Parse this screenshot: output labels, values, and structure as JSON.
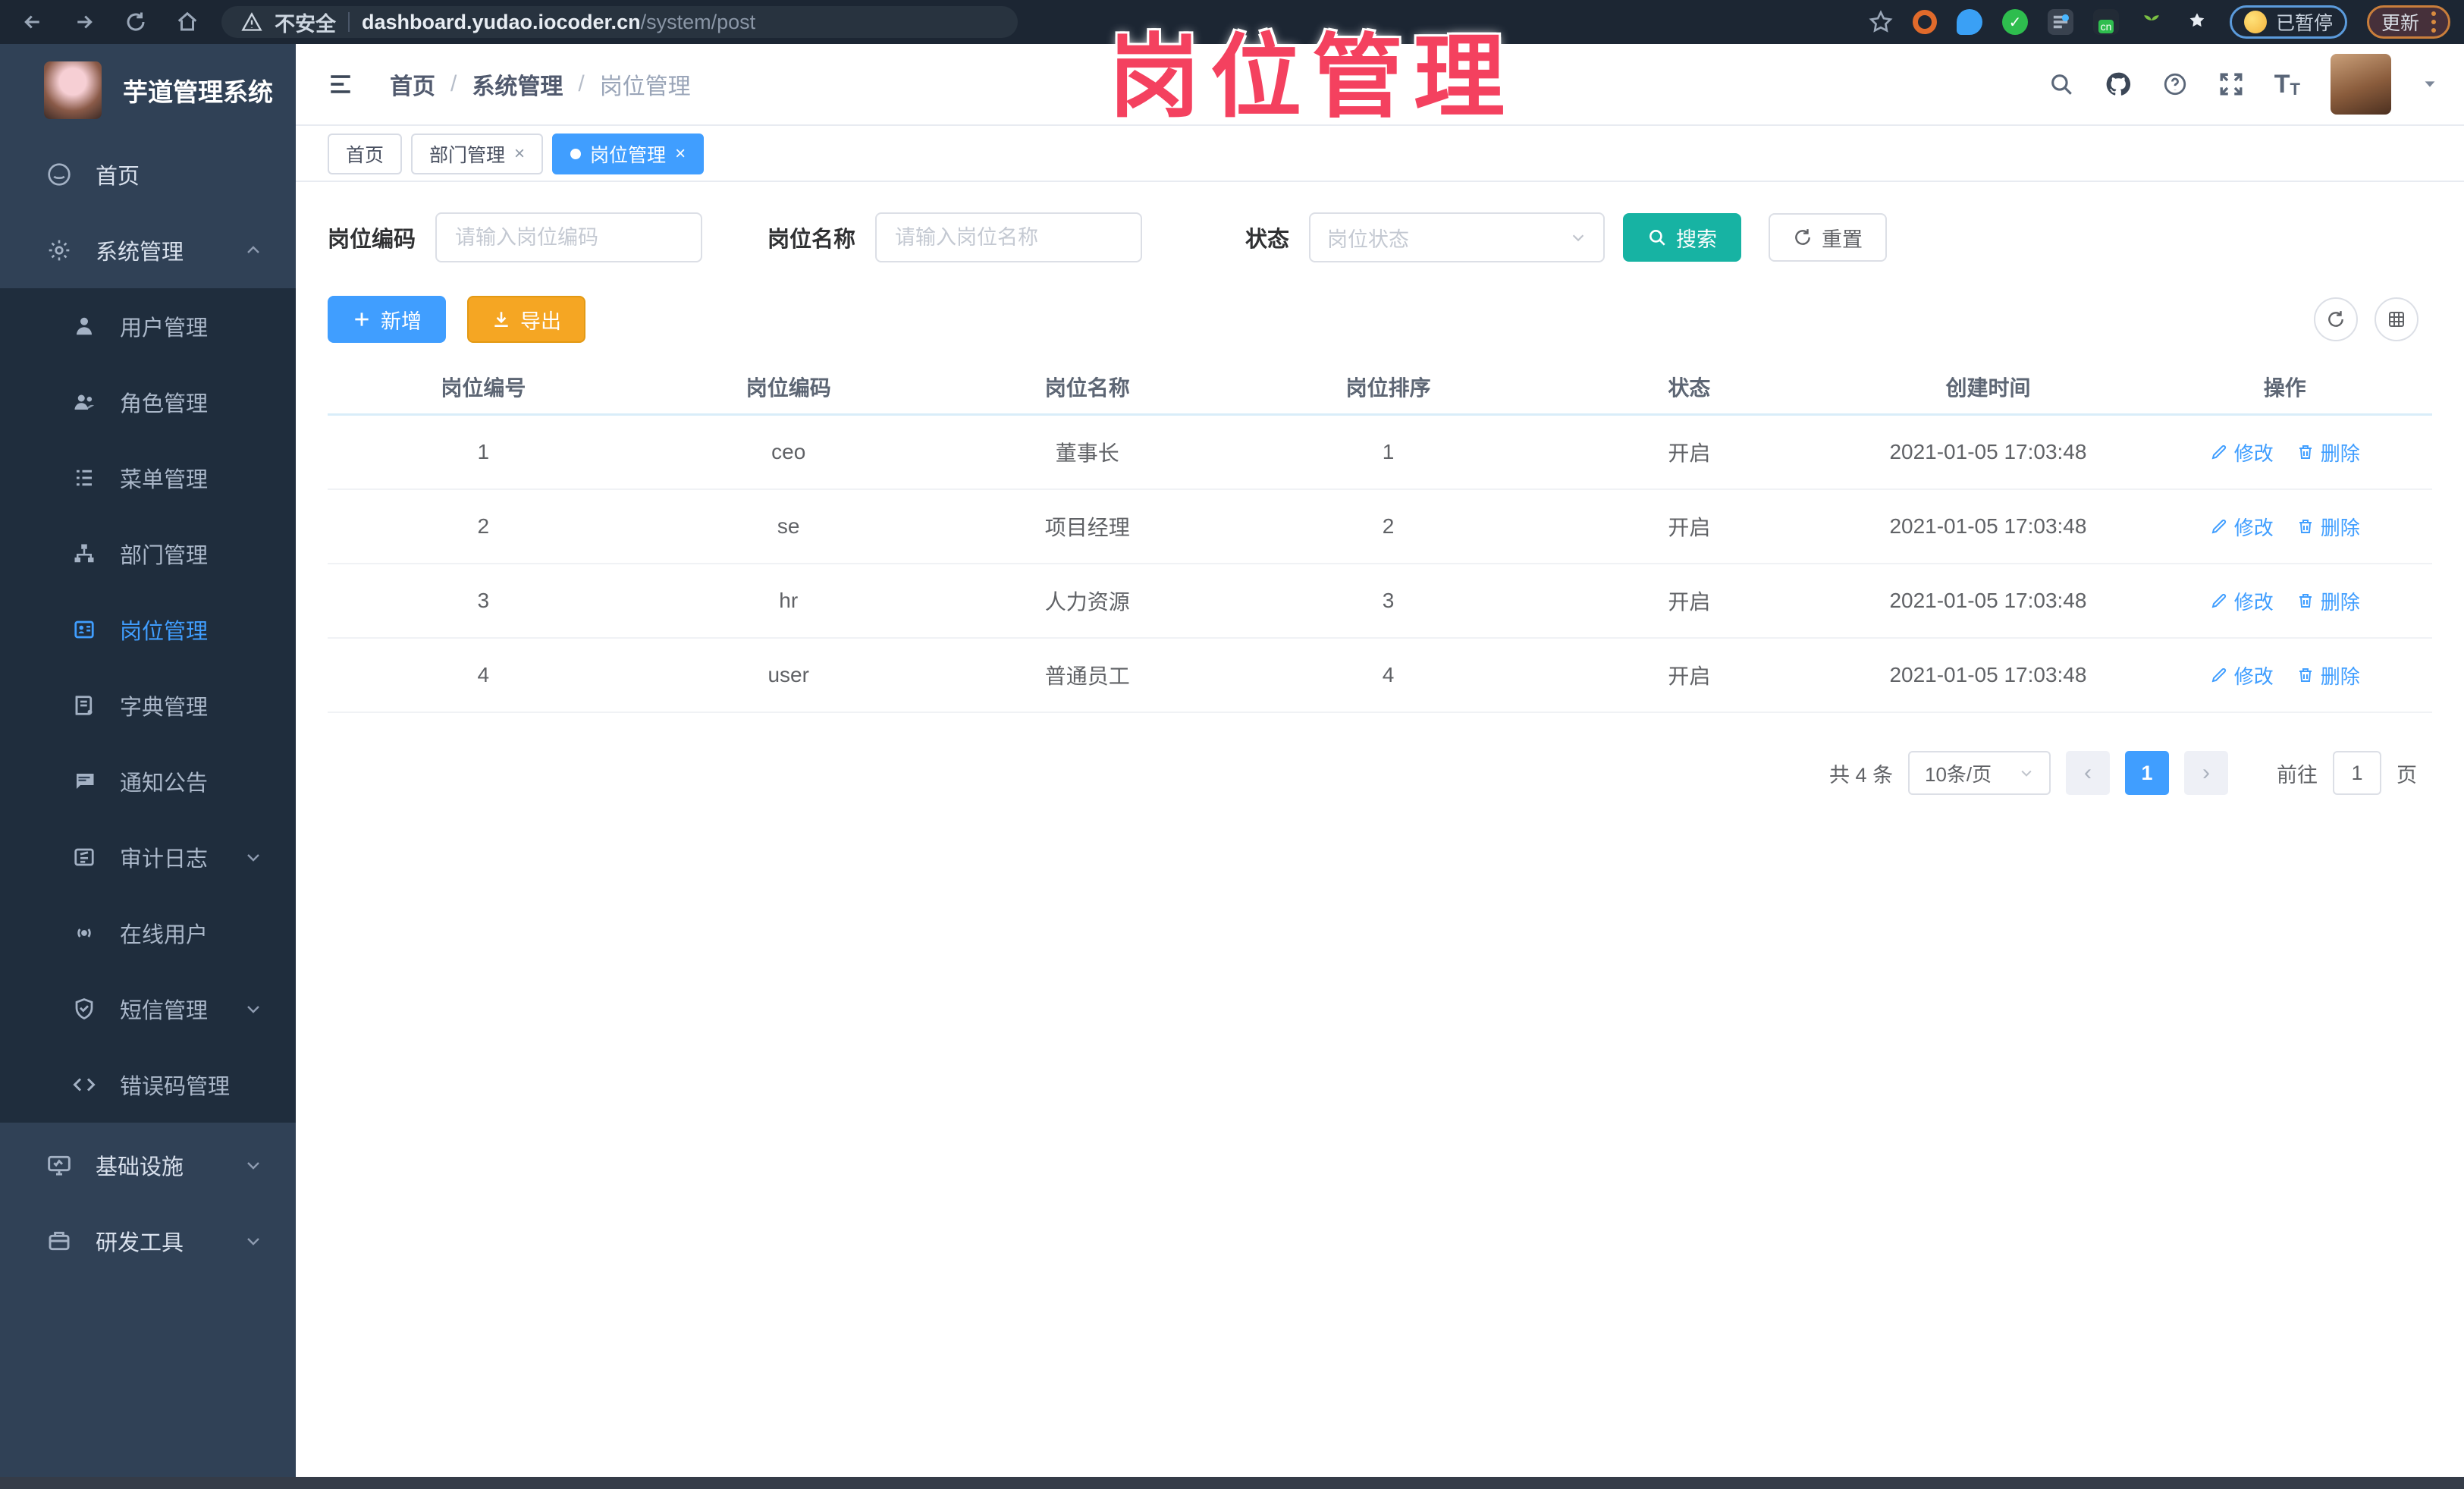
{
  "browser": {
    "security_label": "不安全",
    "url_host": "dashboard.yudao.iocoder.cn",
    "url_path": "/system/post",
    "paused_badge": "已暂停",
    "update_label": "更新"
  },
  "annotation": {
    "text": "岗位管理",
    "color": "#f4415f"
  },
  "sidebar": {
    "title": "芋道管理系统",
    "home_label": "首页",
    "system_label": "系统管理",
    "submenu": [
      {
        "label": "用户管理",
        "icon": "user-icon"
      },
      {
        "label": "角色管理",
        "icon": "roles-icon"
      },
      {
        "label": "菜单管理",
        "icon": "menu-list-icon"
      },
      {
        "label": "部门管理",
        "icon": "org-tree-icon"
      },
      {
        "label": "岗位管理",
        "icon": "post-badge-icon",
        "active": true
      },
      {
        "label": "字典管理",
        "icon": "dictionary-icon"
      },
      {
        "label": "通知公告",
        "icon": "notice-icon"
      },
      {
        "label": "审计日志",
        "icon": "audit-log-icon",
        "expandable": true
      },
      {
        "label": "在线用户",
        "icon": "online-users-icon"
      },
      {
        "label": "短信管理",
        "icon": "sms-icon",
        "expandable": true
      },
      {
        "label": "错误码管理",
        "icon": "error-code-icon"
      }
    ],
    "groups": [
      {
        "label": "基础设施",
        "icon": "infrastructure-icon"
      },
      {
        "label": "研发工具",
        "icon": "dev-tools-icon"
      }
    ]
  },
  "header": {
    "breadcrumb": [
      "首页",
      "系统管理",
      "岗位管理"
    ]
  },
  "tabs": [
    {
      "label": "首页"
    },
    {
      "label": "部门管理"
    },
    {
      "label": "岗位管理"
    }
  ],
  "filters": {
    "code_label": "岗位编码",
    "code_placeholder": "请输入岗位编码",
    "name_label": "岗位名称",
    "name_placeholder": "请输入岗位名称",
    "status_label": "状态",
    "status_placeholder": "岗位状态",
    "search_label": "搜索",
    "reset_label": "重置"
  },
  "toolbar": {
    "add_label": "新增",
    "export_label": "导出"
  },
  "table": {
    "columns": [
      "岗位编号",
      "岗位编码",
      "岗位名称",
      "岗位排序",
      "状态",
      "创建时间",
      "操作"
    ],
    "edit_label": "修改",
    "delete_label": "删除",
    "rows": [
      {
        "id": "1",
        "code": "ceo",
        "name": "董事长",
        "sort": "1",
        "status": "开启",
        "created": "2021-01-05 17:03:48"
      },
      {
        "id": "2",
        "code": "se",
        "name": "项目经理",
        "sort": "2",
        "status": "开启",
        "created": "2021-01-05 17:03:48"
      },
      {
        "id": "3",
        "code": "hr",
        "name": "人力资源",
        "sort": "3",
        "status": "开启",
        "created": "2021-01-05 17:03:48"
      },
      {
        "id": "4",
        "code": "user",
        "name": "普通员工",
        "sort": "4",
        "status": "开启",
        "created": "2021-01-05 17:03:48"
      }
    ]
  },
  "pagination": {
    "total_text": "共 4 条",
    "page_size": "10条/页",
    "current_page": "1",
    "goto_label": "前往",
    "goto_value": "1",
    "page_label": "页"
  },
  "colors": {
    "primary": "#409eff",
    "search_teal": "#17b3a3",
    "export_orange": "#f5a623",
    "sidebar_bg": "#304156",
    "submenu_bg": "#1f2d3d",
    "annotation_pink": "#f4415f"
  }
}
